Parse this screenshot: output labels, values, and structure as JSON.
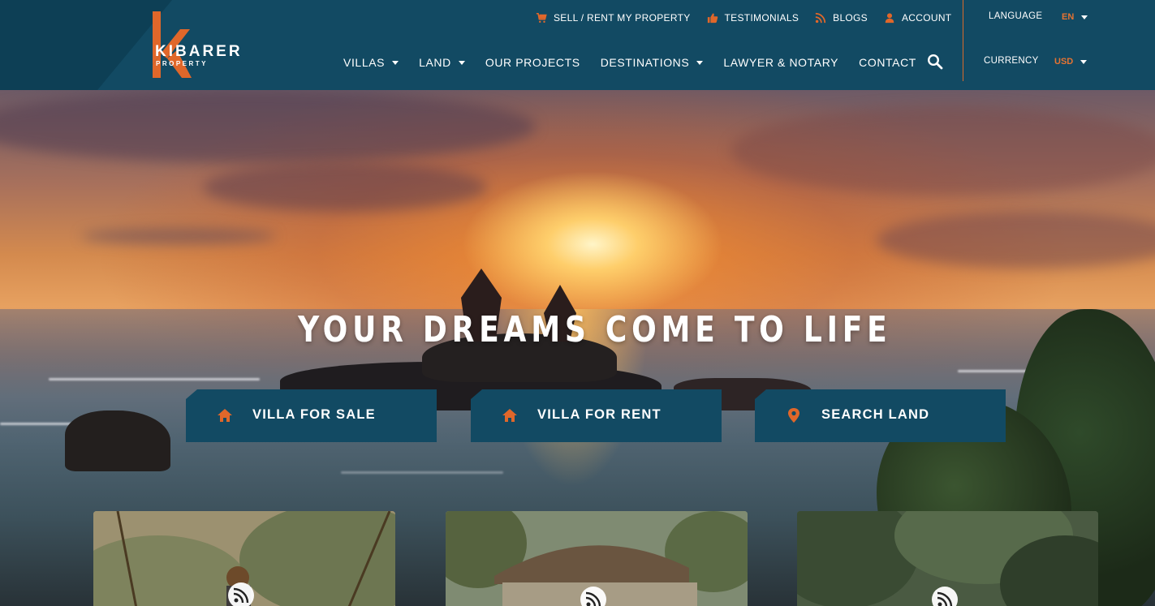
{
  "brand": {
    "name": "KIBARER",
    "tagline": "PROPERTY",
    "accent_color": "#e0672a",
    "header_color": "#124a63"
  },
  "topnav": [
    {
      "label": "SELL / RENT MY PROPERTY",
      "icon": "cart-icon"
    },
    {
      "label": "TESTIMONIALS",
      "icon": "thumbs-up-icon"
    },
    {
      "label": "BLOGS",
      "icon": "rss-icon"
    },
    {
      "label": "ACCOUNT",
      "icon": "user-icon"
    }
  ],
  "mainnav": [
    {
      "label": "VILLAS",
      "dropdown": true
    },
    {
      "label": "LAND",
      "dropdown": true
    },
    {
      "label": "OUR PROJECTS",
      "dropdown": false
    },
    {
      "label": "DESTINATIONS",
      "dropdown": true
    },
    {
      "label": "LAWYER & NOTARY",
      "dropdown": false
    },
    {
      "label": "CONTACT",
      "dropdown": false
    }
  ],
  "settings": {
    "language_label": "LANGUAGE",
    "language_value": "EN",
    "currency_label": "CURRENCY",
    "currency_value": "USD"
  },
  "hero": {
    "headline": "YOUR DREAMS COME TO LIFE",
    "ctas": [
      {
        "label": "VILLA FOR SALE",
        "icon": "home-icon"
      },
      {
        "label": "VILLA FOR RENT",
        "icon": "home-icon"
      },
      {
        "label": "SEARCH LAND",
        "icon": "map-pin-icon"
      }
    ]
  }
}
